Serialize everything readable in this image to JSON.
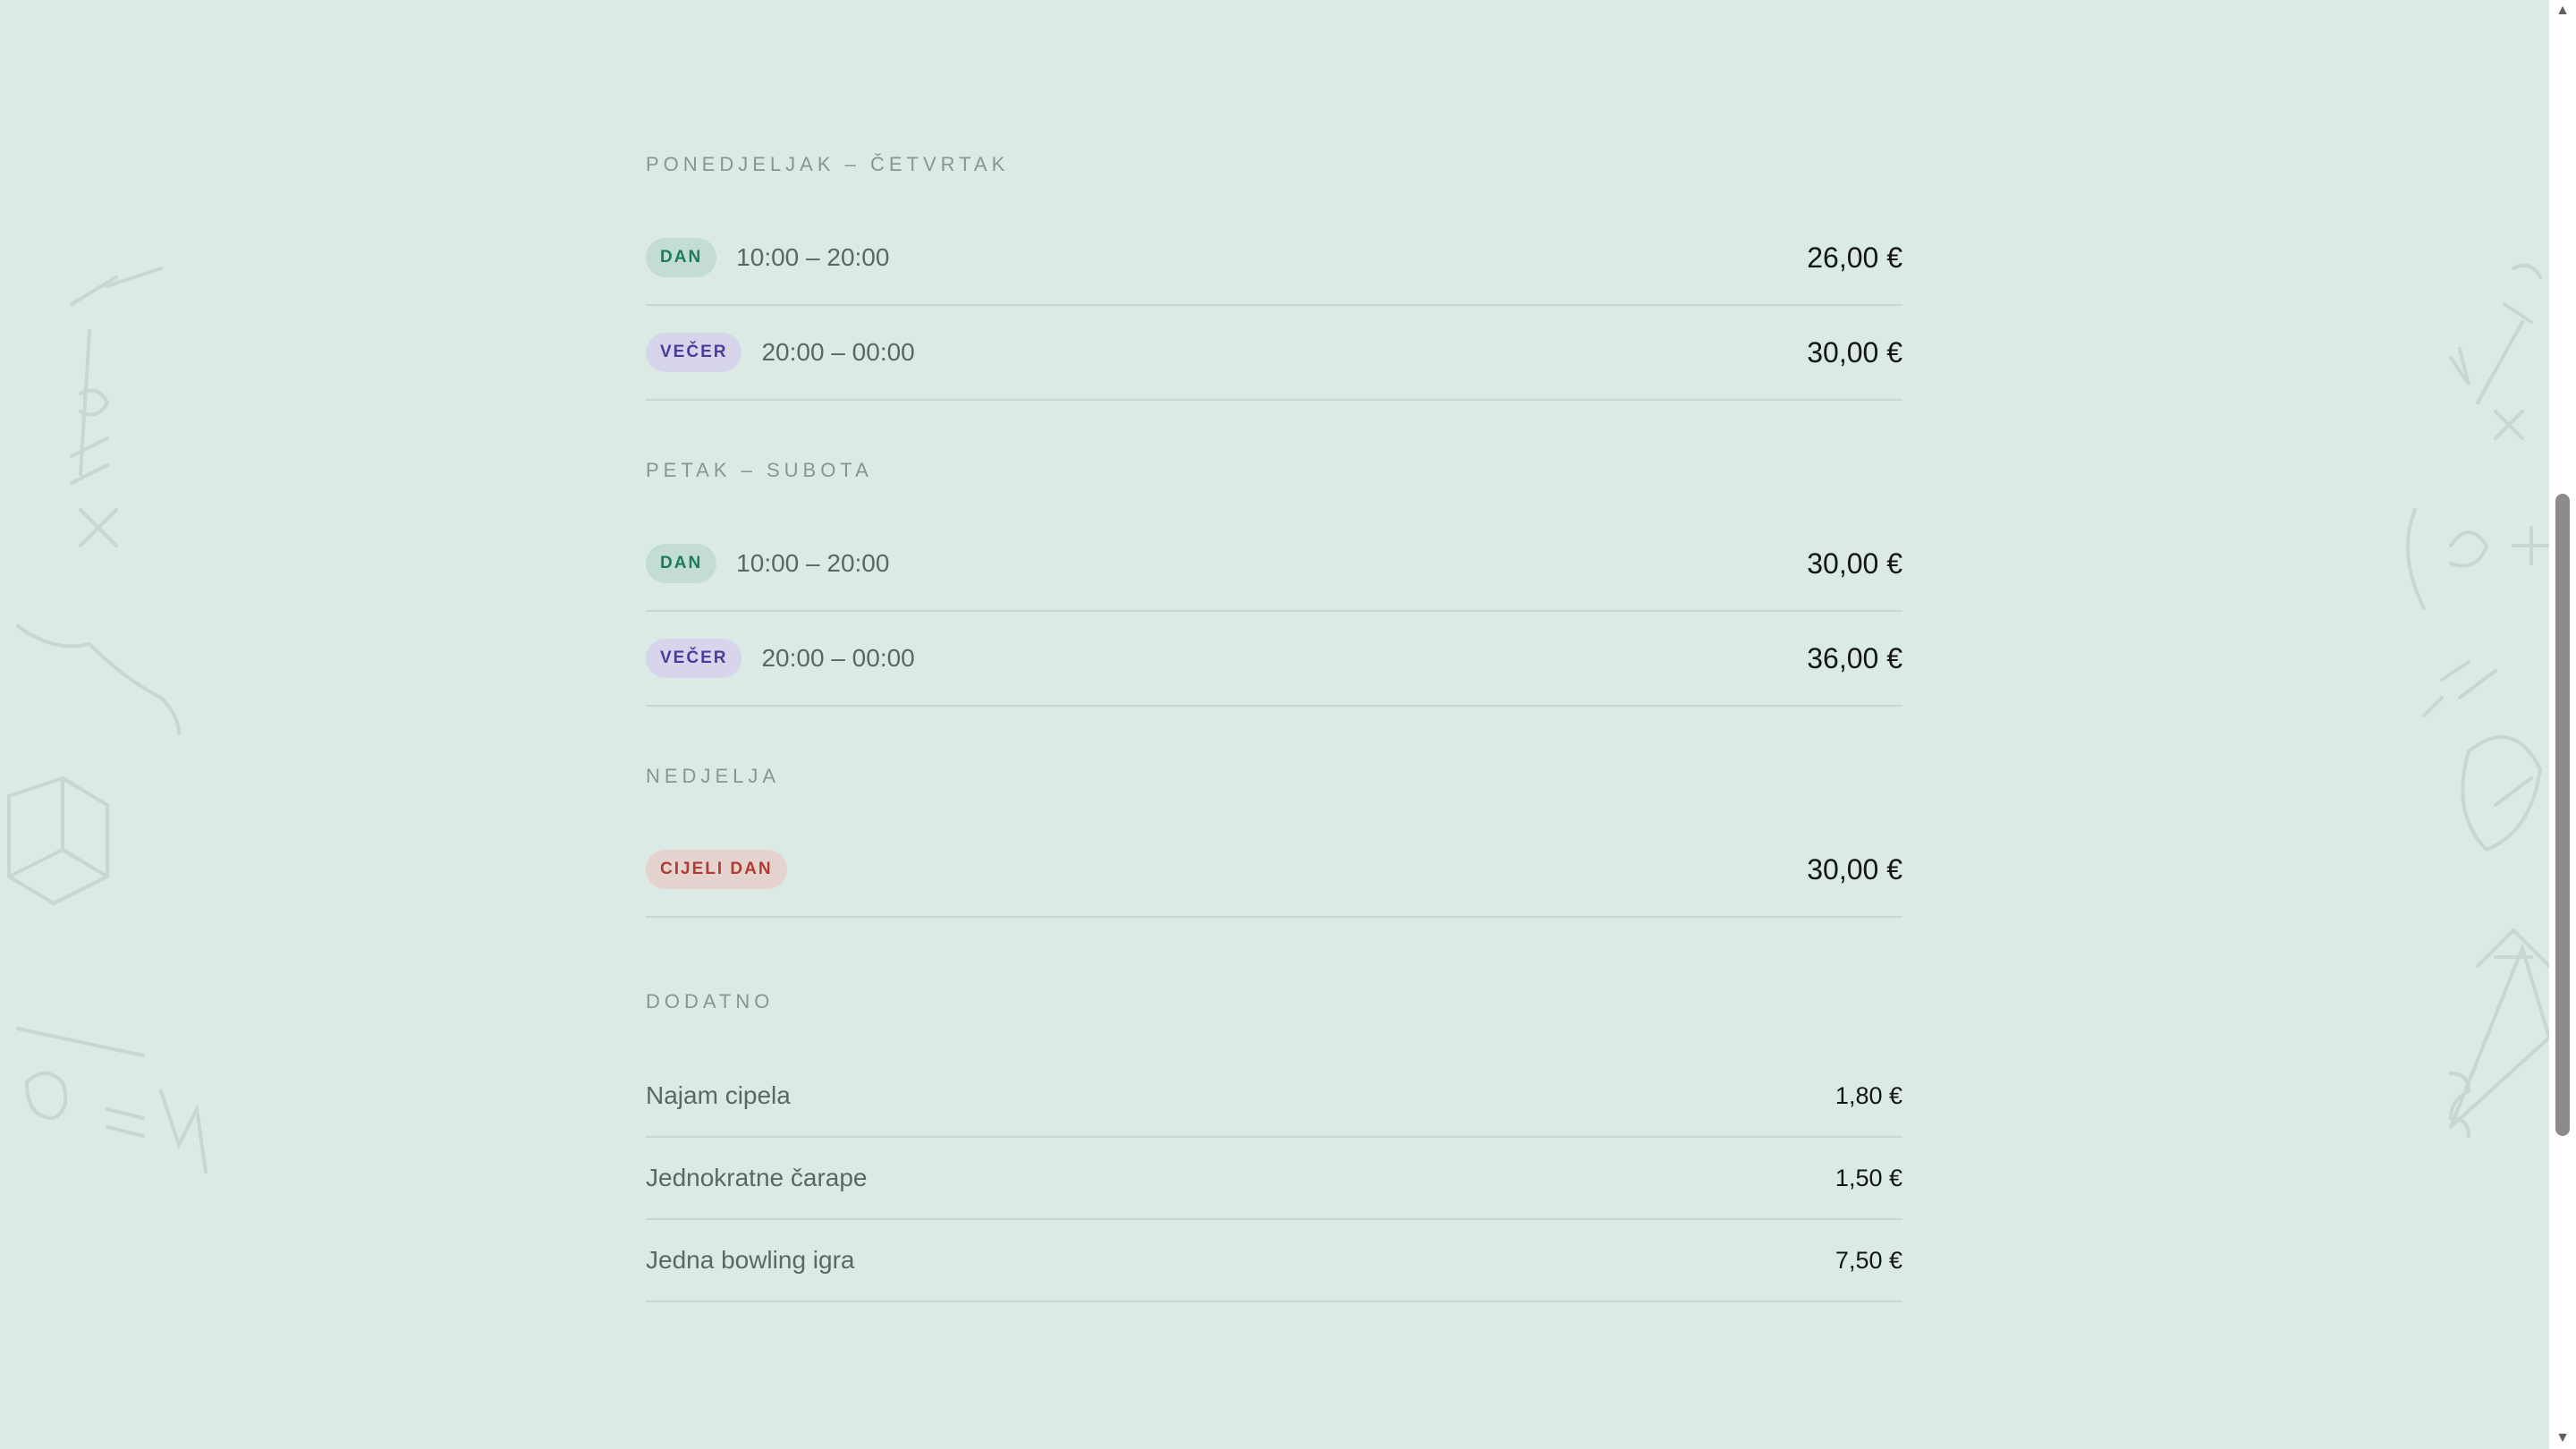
{
  "sections": [
    {
      "title": "PONEDJELJAK – ČETVRTAK",
      "rows": [
        {
          "badge": "DAN",
          "time": "10:00 – 20:00",
          "price": "26,00 €"
        },
        {
          "badge": "VEČER",
          "time": "20:00 – 00:00",
          "price": "30,00 €"
        }
      ]
    },
    {
      "title": "PETAK – SUBOTA",
      "rows": [
        {
          "badge": "DAN",
          "time": "10:00 – 20:00",
          "price": "30,00 €"
        },
        {
          "badge": "VEČER",
          "time": "20:00 – 00:00",
          "price": "36,00 €"
        }
      ]
    },
    {
      "title": "NEDJELJA",
      "rows": [
        {
          "badge": "CIJELI DAN",
          "time": "",
          "price": "30,00 €"
        }
      ]
    }
  ],
  "extras": {
    "title": "DODATNO",
    "items": [
      {
        "label": "Najam cipela",
        "price": "1,80 €"
      },
      {
        "label": "Jednokratne čarape",
        "price": "1,50 €"
      },
      {
        "label": "Jedna bowling igra",
        "price": "7,50 €"
      }
    ]
  },
  "colors": {
    "background": "#dceae6",
    "badge_day": "#1e7a5d",
    "badge_evening": "#4b3c9c",
    "badge_allday": "#b23a32"
  },
  "icons": {
    "scroll_up": "scroll-up-arrow-icon",
    "scroll_down": "scroll-down-arrow-icon"
  }
}
